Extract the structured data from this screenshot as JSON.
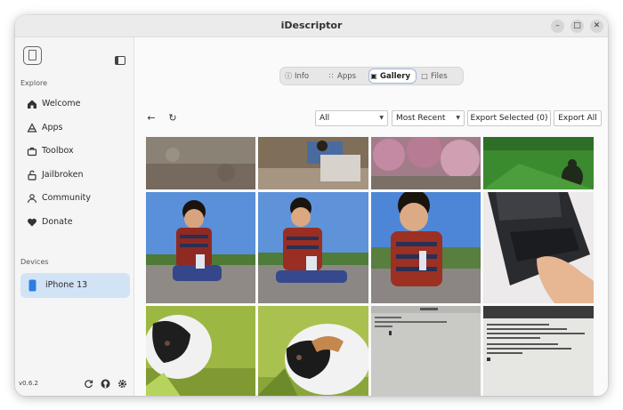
{
  "window": {
    "title": "iDescriptor"
  },
  "sidebar": {
    "explore_label": "Explore",
    "items": [
      {
        "label": "Welcome",
        "icon": "home-icon"
      },
      {
        "label": "Apps",
        "icon": "apps-icon"
      },
      {
        "label": "Toolbox",
        "icon": "toolbox-icon"
      },
      {
        "label": "Jailbroken",
        "icon": "unlock-icon"
      },
      {
        "label": "Community",
        "icon": "community-icon"
      },
      {
        "label": "Donate",
        "icon": "heart-icon"
      }
    ],
    "devices_label": "Devices",
    "device": {
      "label": "iPhone 13",
      "icon": "phone-icon"
    },
    "version": "v0.6.2"
  },
  "tabs": [
    {
      "label": "Info",
      "icon": "info-icon",
      "active": false
    },
    {
      "label": "Apps",
      "icon": "apps-icon",
      "active": false
    },
    {
      "label": "Gallery",
      "icon": "image-icon",
      "active": true
    },
    {
      "label": "Files",
      "icon": "folder-icon",
      "active": false
    }
  ],
  "toolbar": {
    "filter_value": "All",
    "sort_value": "Most Recent",
    "export_selected_label": "Export Selected (0)",
    "export_all_label": "Export All"
  },
  "colors": {
    "accent": "#d3e3f6",
    "device_icon": "#2f7de1"
  }
}
